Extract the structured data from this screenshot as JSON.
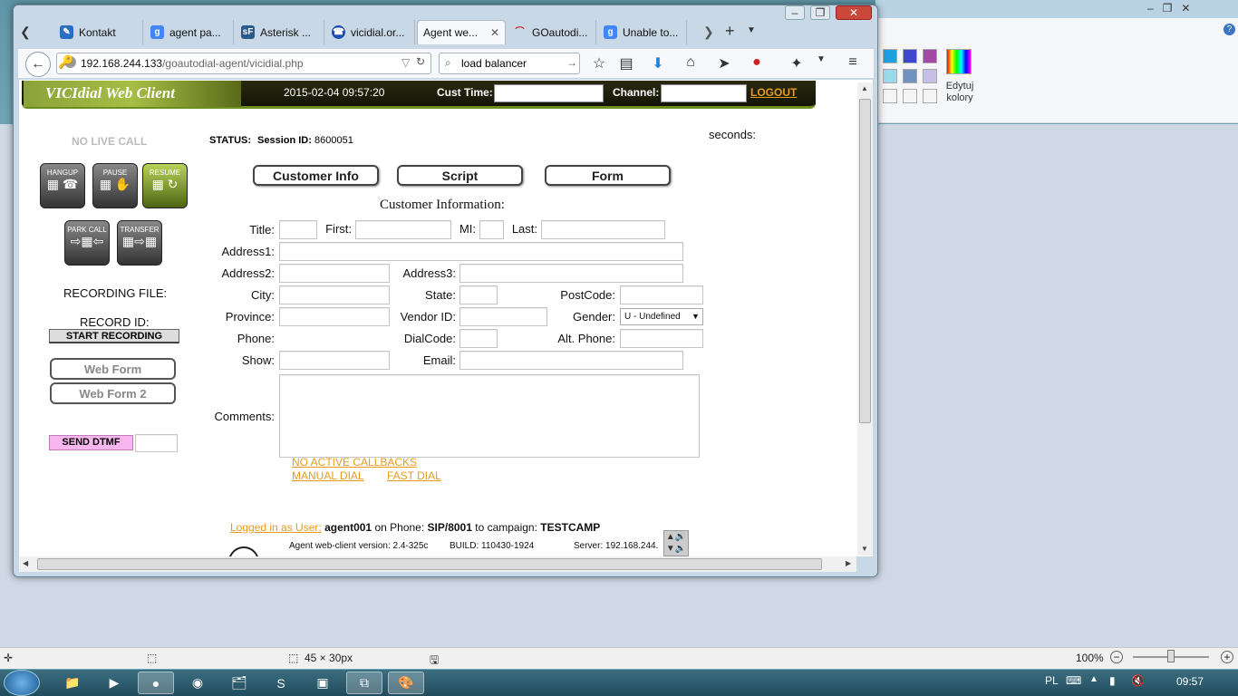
{
  "browser": {
    "tabs": [
      {
        "label": "Kontakt"
      },
      {
        "label": "agent pa..."
      },
      {
        "label": "Asterisk ..."
      },
      {
        "label": "vicidial.or..."
      },
      {
        "label": "Agent we..."
      },
      {
        "label": "GOautodi..."
      },
      {
        "label": "Unable to..."
      }
    ],
    "url_host": "192.168.244.133",
    "url_path": "/goautodial-agent/vicidial.php",
    "search_value": "load balancer"
  },
  "vicidial": {
    "logo_text": "VICIdial Web Client",
    "datetime": "2015-02-04 09:57:20",
    "cust_time_label": "Cust Time:",
    "channel_label": "Channel:",
    "logout_label": "LOGOUT",
    "no_live_call": "NO LIVE CALL",
    "status_label": "STATUS:",
    "session_label": "Session ID:",
    "session_id": "8600051",
    "seconds_label": "seconds:",
    "buttons": {
      "hangup": "HANGUP",
      "pause": "PAUSE",
      "resume": "RESUME",
      "park": "PARK CALL",
      "transfer": "TRANSFER"
    },
    "recording_file_label": "RECORDING FILE:",
    "record_id_label": "RECORD ID:",
    "start_recording": "START RECORDING",
    "web_form": "Web Form",
    "web_form_2": "Web Form 2",
    "send_dtmf": "SEND DTMF",
    "tabs": {
      "customer_info": "Customer Info",
      "script": "Script",
      "form": "Form"
    },
    "section_title": "Customer Information:",
    "fields": {
      "title": "Title:",
      "first": "First:",
      "mi": "MI:",
      "last": "Last:",
      "address1": "Address1:",
      "address2": "Address2:",
      "address3": "Address3:",
      "city": "City:",
      "state": "State:",
      "postcode": "PostCode:",
      "province": "Province:",
      "vendor_id": "Vendor ID:",
      "gender": "Gender:",
      "gender_value": "U - Undefined",
      "phone": "Phone:",
      "dialcode": "DialCode:",
      "alt_phone": "Alt. Phone:",
      "show": "Show:",
      "email": "Email:",
      "comments": "Comments:"
    },
    "links": {
      "callbacks": "NO ACTIVE CALLBACKS",
      "manual_dial": "MANUAL DIAL",
      "fast_dial": "FAST DIAL"
    },
    "footer": {
      "logged_in_as": "Logged in as User:",
      "user": "agent001",
      "on_phone": "on Phone:",
      "phone": "SIP/8001",
      "to_campaign": "to campaign:",
      "campaign": "TESTCAMP",
      "version": "Agent web-client version: 2.4-325c",
      "build": "BUILD: 110430-1924",
      "server": "Server: 192.168.244."
    }
  },
  "paint": {
    "edit_colors": "Edytuj kolory",
    "status_size": "45 × 30px",
    "zoom": "100%"
  },
  "taskbar": {
    "lang": "PL",
    "clock": "09:57"
  },
  "colors": {
    "vicidial_green": "#8aa33a",
    "link_orange": "#e69a1e",
    "send_dtmf_bg": "#f7b6f0"
  }
}
